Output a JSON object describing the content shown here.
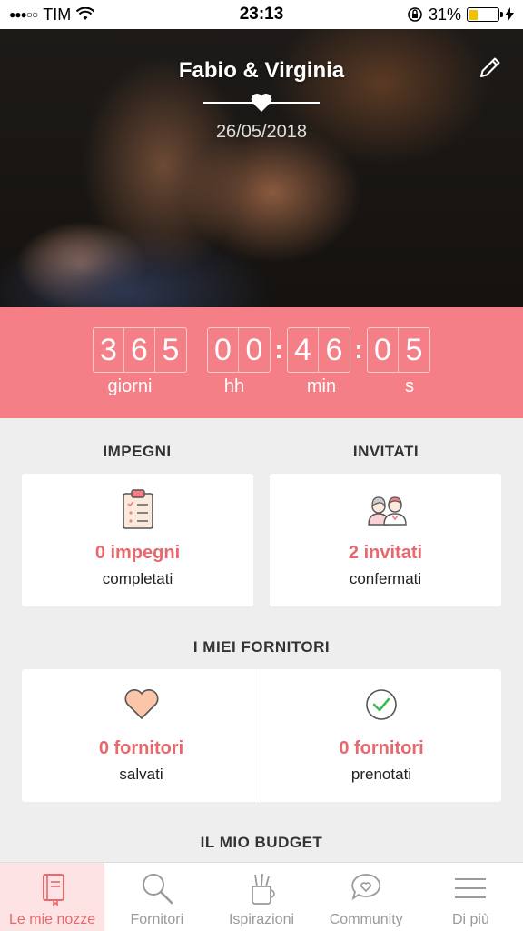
{
  "status_bar": {
    "signal": "●●●○○",
    "carrier": "TIM",
    "time": "23:13",
    "battery_percent": "31%",
    "battery_level": 0.31
  },
  "hero": {
    "couple_names": "Fabio & Virginia",
    "wedding_date": "26/05/2018"
  },
  "countdown": {
    "days": [
      "3",
      "6",
      "5"
    ],
    "hours": [
      "0",
      "0"
    ],
    "minutes": [
      "4",
      "6"
    ],
    "seconds": [
      "0",
      "5"
    ],
    "labels": {
      "days": "giorni",
      "hours": "hh",
      "minutes": "min",
      "seconds": "s"
    }
  },
  "sections": {
    "tasks_title": "IMPEGNI",
    "guests_title": "INVITATI",
    "vendors_title": "I MIEI FORNITORI",
    "budget_title": "IL MIO BUDGET"
  },
  "cards": {
    "tasks": {
      "count": "0 impegni",
      "sub": "completati"
    },
    "guests": {
      "count": "2 invitati",
      "sub": "confermati"
    },
    "vendors_saved": {
      "count": "0 fornitori",
      "sub": "salvati"
    },
    "vendors_booked": {
      "count": "0 fornitori",
      "sub": "prenotati"
    }
  },
  "tab_bar": {
    "items": [
      {
        "label": "Le mie nozze",
        "icon": "notebook-icon",
        "active": true
      },
      {
        "label": "Fornitori",
        "icon": "search-icon",
        "active": false
      },
      {
        "label": "Ispirazioni",
        "icon": "brushes-icon",
        "active": false
      },
      {
        "label": "Community",
        "icon": "chat-heart-icon",
        "active": false
      },
      {
        "label": "Di più",
        "icon": "menu-icon",
        "active": false
      }
    ]
  },
  "colors": {
    "accent": "#f57f87",
    "accent_text": "#e8686d",
    "background": "#eeeeee"
  }
}
